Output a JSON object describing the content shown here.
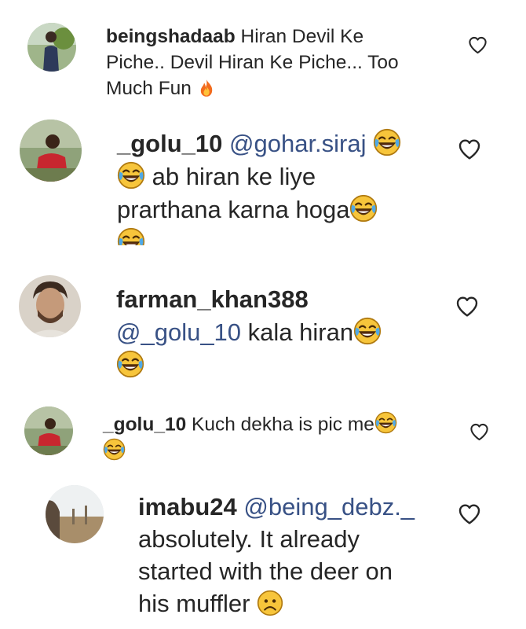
{
  "comments": [
    {
      "username": "beingshadaab",
      "text_line1": "Hiran Devil Ke",
      "text_line2": "Piche.. Devil Hiran Ke Piche... Too",
      "text_line3": "Much Fun",
      "emoji": "fire-emoji"
    },
    {
      "username": "_golu_10",
      "mention": "@gohar.siraj",
      "text_line1": "ab hiran ke liye",
      "text_line2": "prarthana karna hoga",
      "emoji": "tears-of-joy-emoji"
    },
    {
      "username": "farman_khan388",
      "mention": "@_golu_10",
      "text_line1": "kala hiran",
      "emoji": "tears-of-joy-emoji"
    },
    {
      "username": "_golu_10",
      "text_line1": "Kuch dekha is pic me",
      "emoji": "tears-of-joy-emoji"
    },
    {
      "username": "imabu24",
      "mention": "@being_debz._",
      "text_line1": "absolutely. It already",
      "text_line2": "started with the deer on",
      "text_line3": "his muffler",
      "emoji": "sad-face-emoji"
    }
  ],
  "colors": {
    "text": "#262626",
    "mention": "#385185",
    "heart_outline": "#262626"
  },
  "icons": {
    "like": "heart-icon"
  }
}
